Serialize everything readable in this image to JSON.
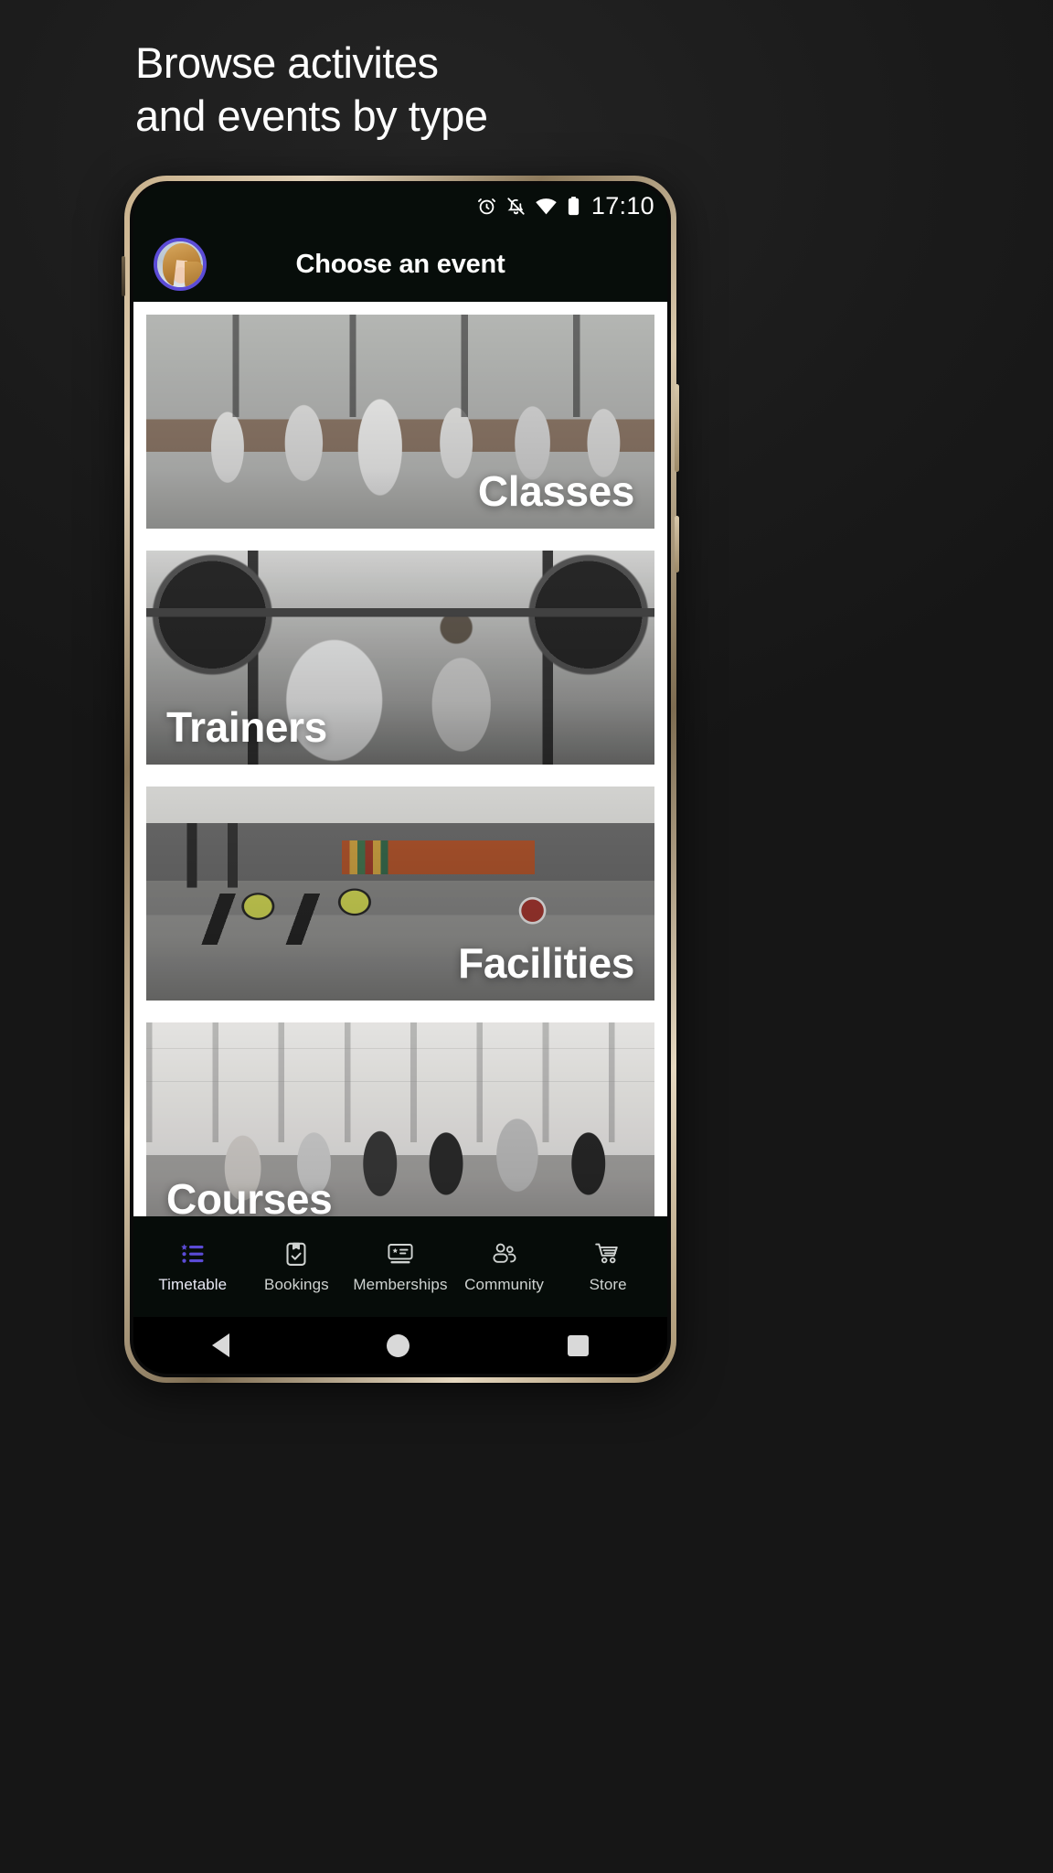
{
  "promo": {
    "headline_line1": "Browse activites",
    "headline_line2": "and events by type"
  },
  "status_bar": {
    "time": "17:10",
    "icons": [
      "alarm-icon",
      "notifications-off-icon",
      "wifi-icon",
      "battery-icon"
    ]
  },
  "app_header": {
    "title": "Choose an event",
    "avatar_name": "user-avatar"
  },
  "cards": [
    {
      "label": "Classes",
      "align": "right",
      "image_name": "classes-photo"
    },
    {
      "label": "Trainers",
      "align": "left",
      "image_name": "trainers-photo"
    },
    {
      "label": "Facilities",
      "align": "right",
      "image_name": "facilities-photo"
    },
    {
      "label": "Courses",
      "align": "left",
      "image_name": "courses-photo"
    }
  ],
  "bottom_nav": {
    "active_index": 0,
    "active_color": "#5b4bd6",
    "inactive_color": "#cfd3d1",
    "items": [
      {
        "label": "Timetable",
        "icon": "list-star-icon"
      },
      {
        "label": "Bookings",
        "icon": "clipboard-check-icon"
      },
      {
        "label": "Memberships",
        "icon": "membership-card-icon"
      },
      {
        "label": "Community",
        "icon": "people-icon"
      },
      {
        "label": "Store",
        "icon": "shopping-cart-icon"
      }
    ]
  },
  "system_nav": {
    "back": "back-triangle",
    "home": "home-circle",
    "recents": "recents-square"
  }
}
